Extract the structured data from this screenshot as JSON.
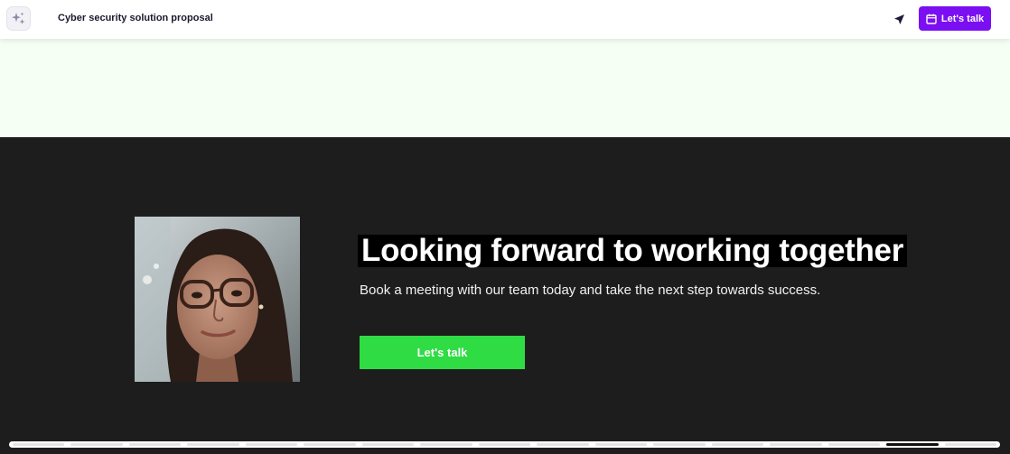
{
  "header": {
    "title": "Cyber security solution proposal",
    "cta_label": "Let's talk",
    "logo_icon": "sparkle-icon",
    "share_icon": "send-arrow-icon",
    "calendar_icon": "calendar-icon",
    "accent_color": "#7a0ff2"
  },
  "hero": {
    "headline": "Looking forward to working together",
    "subtext": "Book a meeting with our team today and take the next step towards success.",
    "cta_label": "Let's talk",
    "cta_color": "#2fdc44",
    "background_color": "#1d1d1d"
  },
  "progress": {
    "segments": 17,
    "active_index": 15
  }
}
